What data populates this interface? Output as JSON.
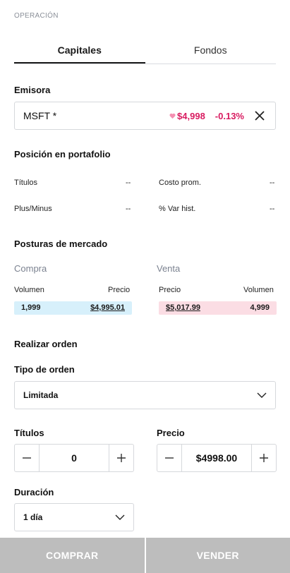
{
  "section_label": "OPERACIÓN",
  "tabs": [
    {
      "label": "Capitales",
      "active": true
    },
    {
      "label": "Fondos",
      "active": false
    }
  ],
  "emisora": {
    "label": "Emisora",
    "ticker": "MSFT *",
    "price": "$4,998",
    "change": "-0.13%",
    "accent_color": "#d81b60"
  },
  "portfolio": {
    "title": "Posición en portafolio",
    "titulos_label": "Títulos",
    "titulos_value": "--",
    "costo_label": "Costo prom.",
    "costo_value": "--",
    "plusminus_label": "Plus/Minus",
    "plusminus_value": "--",
    "var_label": "% Var hist.",
    "var_value": "--"
  },
  "market": {
    "title": "Posturas de mercado",
    "compra_label": "Compra",
    "venta_label": "Venta",
    "compra_col1": "Volumen",
    "compra_col2": "Precio",
    "venta_col1": "Precio",
    "venta_col2": "Volumen",
    "bid_volume": "1,999",
    "bid_price": "$4,995.01",
    "ask_price": "$5,017.99",
    "ask_volume": "4,999",
    "bid_color": "#d7f0fb",
    "ask_color": "#fbdde4"
  },
  "order": {
    "title": "Realizar orden",
    "tipo_label": "Tipo de orden",
    "tipo_value": "Limitada",
    "titulos_label": "Títulos",
    "titulos_value": "0",
    "precio_label": "Precio",
    "precio_value": "$4998.00",
    "duracion_label": "Duración",
    "duracion_value": "1 día"
  },
  "footer": {
    "buy_label": "COMPRAR",
    "sell_label": "VENDER",
    "button_color": "#bdbdbd"
  },
  "icons": {
    "close": "close-icon",
    "chevron": "chevron-down-icon",
    "minus": "minus-icon",
    "plus": "plus-icon",
    "heart": "heart-icon"
  }
}
